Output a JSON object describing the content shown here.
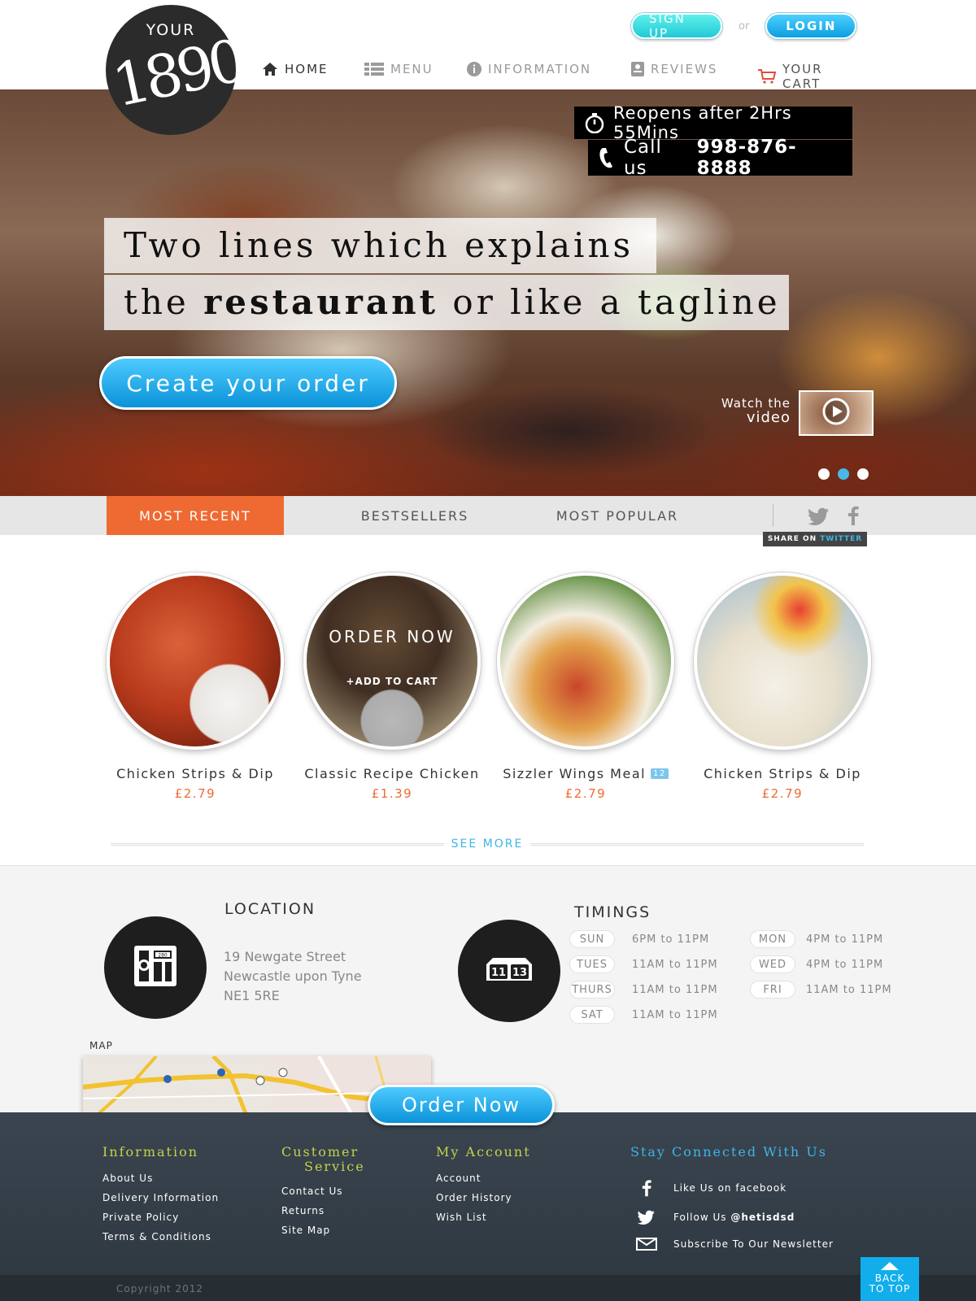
{
  "brand": {
    "logo_top": "YOUR",
    "logo_number": "1890"
  },
  "auth": {
    "signup_label": "SIGN UP",
    "or_label": "or",
    "login_label": "LOGIN"
  },
  "nav": {
    "items": [
      {
        "label": "HOME",
        "icon": "home-icon",
        "active": true
      },
      {
        "label": "MENU",
        "icon": "list-icon"
      },
      {
        "label": "INFORMATION",
        "icon": "info-icon"
      },
      {
        "label": "REVIEWS",
        "icon": "reviews-icon"
      },
      {
        "label": "YOUR CART",
        "icon": "cart-icon"
      }
    ]
  },
  "hero": {
    "reopen_text": "Reopens after 2Hrs 55Mins",
    "call_text": "Call us",
    "phone": "998-876-8888",
    "tagline_line1": "Two lines which explains",
    "tagline_line2_pre": "the ",
    "tagline_line2_bold": "restaurant",
    "tagline_line2_post": " or like a tagline",
    "cta_label": "Create your order",
    "watch_line1": "Watch the",
    "watch_line2": "video",
    "slides": 3,
    "active_slide": 2
  },
  "tabs": {
    "items": [
      "MOST RECENT",
      "BESTSELLERS",
      "MOST POPULAR"
    ],
    "active": 0,
    "share_prefix": "SHARE ON",
    "share_network": "TWITTER"
  },
  "products": {
    "items": [
      {
        "name": "Chicken Strips & Dip",
        "price": "£2.79"
      },
      {
        "name": "Classic Recipe Chicken",
        "price": "£1.39",
        "overlay_title": "ORDER NOW",
        "overlay_action": "+ADD TO CART"
      },
      {
        "name": "Sizzler Wings Meal",
        "price": "£2.79",
        "badge": "12"
      },
      {
        "name": "Chicken Strips & Dip",
        "price": "£2.79"
      }
    ],
    "see_more_label": "SEE MORE"
  },
  "location": {
    "title": "LOCATION",
    "line1": "19 Newgate Street",
    "line2": "Newcastle upon Tyne",
    "line3": "NE1 5RE",
    "map_label": "MAP"
  },
  "timings": {
    "title": "TIMINGS",
    "left": [
      {
        "day": "SUN",
        "hours": "6PM to 11PM"
      },
      {
        "day": "TUES",
        "hours": "11AM to 11PM"
      },
      {
        "day": "THURS",
        "hours": "11AM to 11PM"
      },
      {
        "day": "SAT",
        "hours": "11AM to 11PM"
      }
    ],
    "right": [
      {
        "day": "MON",
        "hours": "4PM to 11PM"
      },
      {
        "day": "WED",
        "hours": "4PM to 11PM"
      },
      {
        "day": "FRI",
        "hours": "11AM to 11PM"
      }
    ],
    "clock_left": "11",
    "clock_right": "13"
  },
  "order_now_label": "Order Now",
  "footer": {
    "information": {
      "title": "Information",
      "links": [
        "About Us",
        "Delivery Information",
        "Private Policy",
        "Terms & Conditions"
      ]
    },
    "customer_service": {
      "title_line1": "Customer",
      "title_line2": "Service",
      "links": [
        "Contact Us",
        "Returns",
        "Site Map"
      ]
    },
    "my_account": {
      "title": "My Account",
      "links": [
        "Account",
        "Order History",
        "Wish List"
      ]
    },
    "stay_connected": {
      "title": "Stay Connected With Us",
      "facebook": "Like Us on facebook",
      "twitter_prefix": "Follow Us",
      "twitter_handle": "@hetisdsd",
      "newsletter": "Subscribe To Our Newsletter"
    },
    "copyright": "Copyright 2012",
    "back_line1": "BACK",
    "back_line2": "TO TOP"
  },
  "colors": {
    "accent_blue": "#11aeeb",
    "accent_orange": "#ef6a32",
    "footer_heading": "#c5d24a"
  }
}
